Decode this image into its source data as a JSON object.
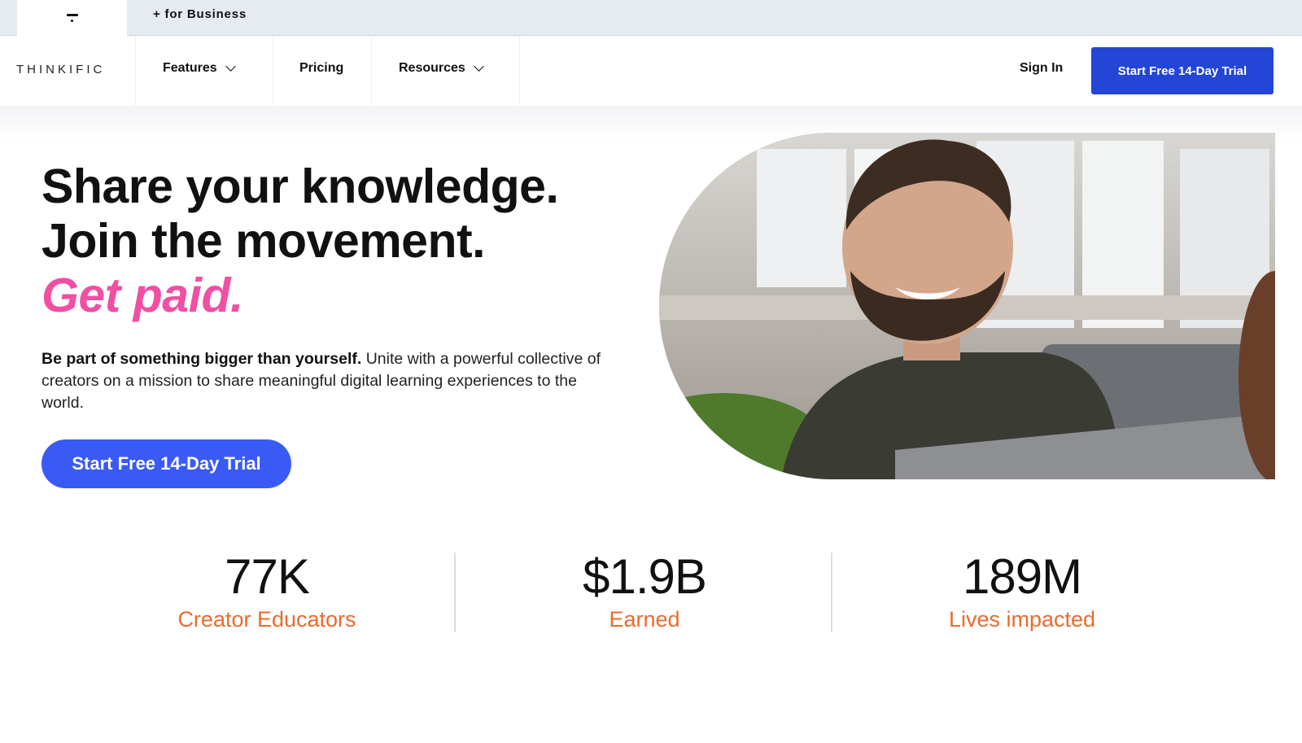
{
  "topbar": {
    "business_link": "+ for Business"
  },
  "nav": {
    "brand": "THINKIFIC",
    "items": [
      {
        "label": "Features",
        "has_dropdown": true
      },
      {
        "label": "Pricing",
        "has_dropdown": false
      },
      {
        "label": "Resources",
        "has_dropdown": true
      }
    ],
    "sign_in": "Sign In",
    "cta": "Start Free 14-Day Trial"
  },
  "hero": {
    "line1": "Share your knowledge.",
    "line2": "Join the movement.",
    "accent": "Get paid.",
    "lead_bold": "Be part of something bigger than yourself.",
    "lead_rest": " Unite with a powerful collective of creators on a mission to share meaningful digital learning experiences to the world.",
    "cta": "Start Free 14-Day Trial"
  },
  "stats": [
    {
      "value": "77K",
      "label": "Creator Educators"
    },
    {
      "value": "$1.9B",
      "label": "Earned"
    },
    {
      "value": "189M",
      "label": "Lives impacted"
    }
  ],
  "colors": {
    "primary_button": "#2446d6",
    "hero_button": "#3a5af6",
    "accent_pink": "#f04fa3",
    "stat_orange": "#ec6a2c"
  }
}
